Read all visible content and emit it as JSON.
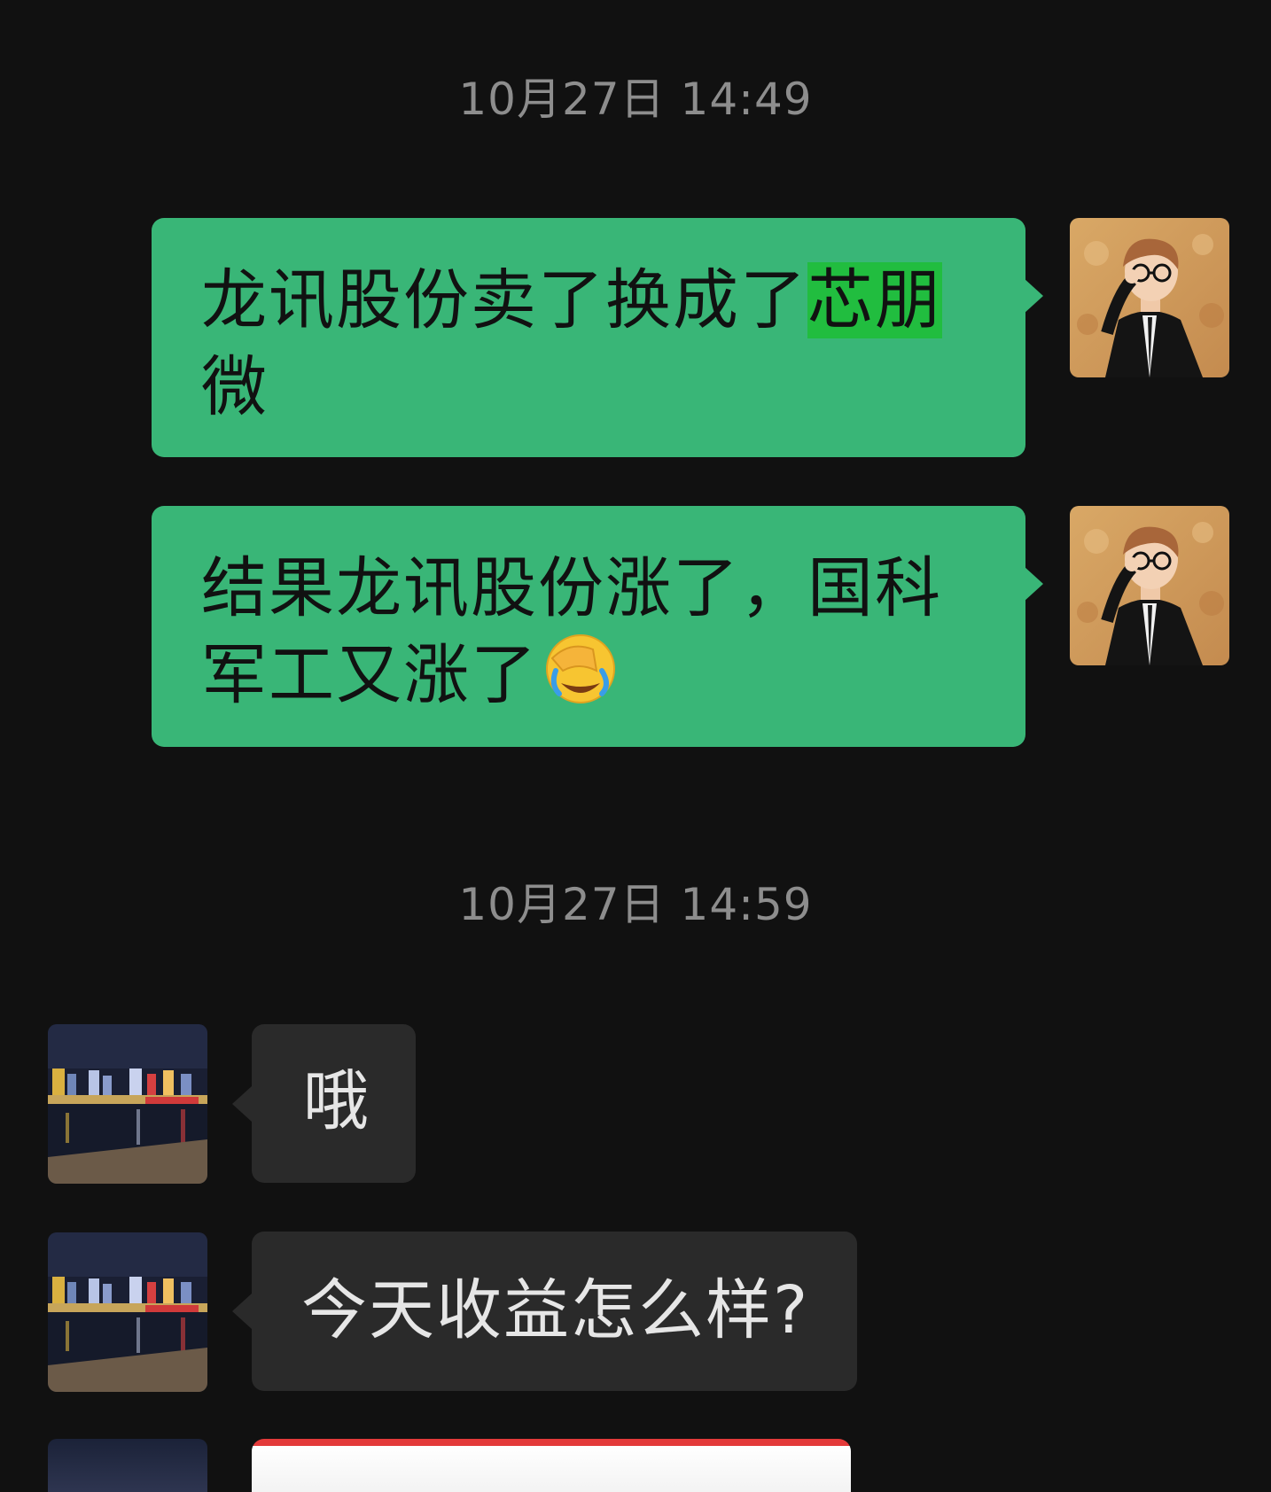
{
  "chat": {
    "timestamp_1": "10月27日 14:49",
    "timestamp_2": "10月27日 14:59",
    "messages": [
      {
        "direction": "outgoing",
        "text_part_1": "龙讯股份卖了换成了",
        "text_highlight": "芯朋",
        "text_part_2": "微"
      },
      {
        "direction": "outgoing",
        "text": "结果龙讯股份涨了，国科军工又涨了",
        "emoji": "face-palm-tears-emoji"
      },
      {
        "direction": "incoming",
        "text": "哦"
      },
      {
        "direction": "incoming",
        "text": "今天收益怎么样?"
      }
    ]
  },
  "colors": {
    "background": "#111111",
    "outgoing_bubble": "#39b677",
    "incoming_bubble": "#2a2a2a",
    "highlight": "#21bd3f",
    "timestamp": "#8d8d8d"
  }
}
